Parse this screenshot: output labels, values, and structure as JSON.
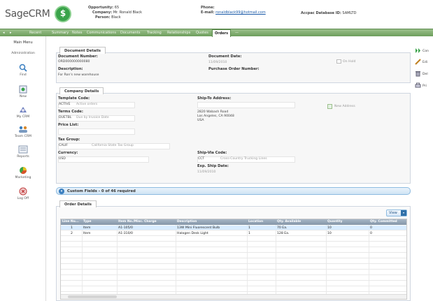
{
  "app": {
    "logo_text": "SageCRM"
  },
  "context": {
    "opportunity_label": "Opportunity:",
    "opportunity_value": "65",
    "company_label": "Company:",
    "company_value": "Mr. Ronald Black",
    "person_label": "Person:",
    "person_value": "Black",
    "phone_label": "Phone:",
    "email_label": "E-mail:",
    "email_value": "ronaldblack99@hotmail.com",
    "db_label": "Accpac Database ID:",
    "db_value": "SAMLTD"
  },
  "tabbar": {
    "nav_back": "◂",
    "nav_forward": "▸",
    "recent": "Recent",
    "tabs": [
      "Summary",
      "Notes",
      "Communications",
      "Documents",
      "Tracking",
      "Relationships",
      "Quotes",
      "Orders",
      "—"
    ],
    "active_tab": "Orders"
  },
  "leftmenu": {
    "title": "Main Menu",
    "items": [
      {
        "label": "Administration",
        "icon": "administration-icon"
      },
      {
        "label": "Find",
        "icon": "find-icon"
      },
      {
        "label": "New",
        "icon": "new-icon"
      },
      {
        "label": "My CRM",
        "icon": "my-crm-icon"
      },
      {
        "label": "Team CRM",
        "icon": "team-crm-icon"
      },
      {
        "label": "Reports",
        "icon": "reports-icon"
      },
      {
        "label": "Marketing",
        "icon": "marketing-icon"
      },
      {
        "label": "Log Off",
        "icon": "log-off-icon"
      }
    ]
  },
  "rightmenu": {
    "items": [
      {
        "label": "Con",
        "icon": "continue-icon"
      },
      {
        "label": "Edi",
        "icon": "edit-icon"
      },
      {
        "label": "Del",
        "icon": "delete-icon"
      },
      {
        "label": "Pri",
        "icon": "print-icon"
      }
    ]
  },
  "document_details": {
    "tab": "Document Details",
    "doc_number_label": "Document Number:",
    "doc_number_value": "ORD000000000080",
    "description_label": "Description:",
    "description_value": "For Ron's new warehouse",
    "doc_date_label": "Document Date:",
    "doc_date_value": "11/09/2010",
    "on_hold_label": "On Hold",
    "po_label": "Purchase Order Number:"
  },
  "company_details": {
    "tab": "Company Details",
    "template_label": "Template Code:",
    "template_code": "ACTIVE",
    "template_desc": "Active orders",
    "terms_label": "Terms Code:",
    "terms_code": "DUETBL",
    "terms_desc": "Due by Invoice Date",
    "price_label": "Price List:",
    "tax_label": "Tax Group:",
    "tax_code": "CALIF",
    "tax_desc": "California State Tax Group",
    "currency_label": "Currency:",
    "currency_value": "USD",
    "shipto_label": "Ship-To Address:",
    "address_line1": "2820 Wabash Road",
    "address_line2": "Los Angeles, CA 90048",
    "address_line3": "USA",
    "new_address": "New Address",
    "shipvia_label": "Ship-Via Code:",
    "shipvia_code": "CCT",
    "shipvia_desc": "Cross-Country Trucking Lines",
    "expship_label": "Exp. Ship Date:",
    "expship_value": "11/09/2010"
  },
  "custom_fields": {
    "text": "Custom Fields - 0 of 46 required",
    "icon": "chevron-down-icon"
  },
  "order_details": {
    "tab": "Order Details",
    "view_button": "View",
    "columns": [
      "Line Nu...",
      "Type",
      "Item No./Misc. Charge",
      "Description",
      "Location",
      "Qty. Available",
      "Quantity",
      "Qty. Committed"
    ],
    "rows": [
      [
        "1",
        "Item",
        "A1-105/0",
        "13W Mini Fluorescent Bulb",
        "1",
        "70 Ea.",
        "10",
        "0"
      ],
      [
        "2",
        "Item",
        "A1-310/0",
        "Halogen Desk Light",
        "1",
        "128 Ea.",
        "10",
        "0"
      ]
    ]
  },
  "colors": {
    "accent_green": "#6d9e5c",
    "link_blue": "#1a5aa8",
    "grid_header": "#8596a8"
  }
}
